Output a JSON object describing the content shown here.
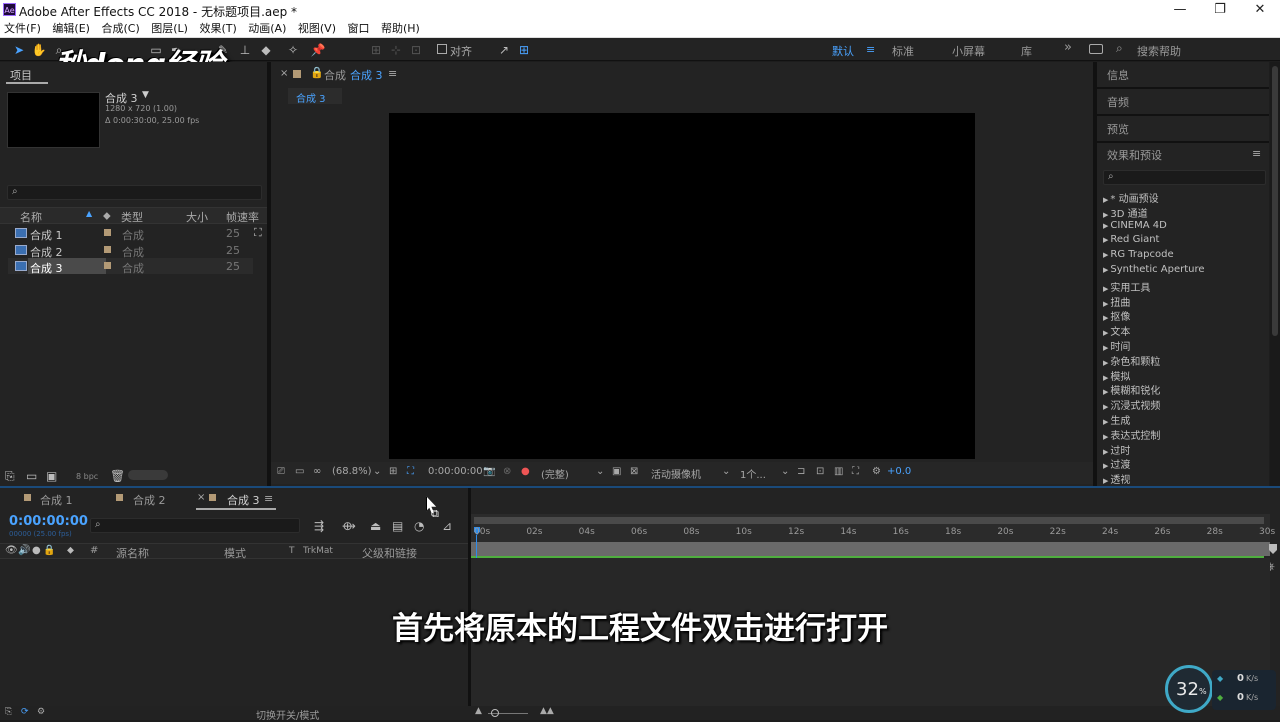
{
  "window": {
    "title": "Adobe After Effects CC 2018 - 无标题项目.aep *",
    "app_icon": "Ae",
    "controls": [
      "minimize-icon",
      "maximize-icon",
      "close-icon"
    ]
  },
  "menu": [
    "文件(F)",
    "编辑(E)",
    "合成(C)",
    "图层(L)",
    "效果(T)",
    "动画(A)",
    "视图(V)",
    "窗口",
    "帮助(H)"
  ],
  "toolbar": {
    "align_label": "对齐",
    "workspaces": [
      "默认",
      "标准",
      "小屏幕",
      "库"
    ],
    "active_workspace": "默认",
    "search_placeholder": "搜索帮助"
  },
  "watermark": "秒dong经验",
  "project": {
    "tab_label": "项目",
    "comp_name": "合成 3",
    "comp_res": "1280 x 720 (1.00)",
    "comp_dur": "Δ 0:00:30:00, 25.00 fps",
    "columns": [
      "名称",
      "类型",
      "大小",
      "帧速率"
    ],
    "items": [
      {
        "name": "合成 1",
        "type": "合成",
        "fps": "25"
      },
      {
        "name": "合成 2",
        "type": "合成",
        "fps": "25"
      },
      {
        "name": "合成 3",
        "type": "合成",
        "fps": "25"
      }
    ],
    "bpc": "8 bpc"
  },
  "composition": {
    "tab_label": "合成",
    "tab_active": "合成 3",
    "flow_label": "合成 3",
    "zoom": "(68.8%)",
    "timecode": "0:00:00:00",
    "quality": "(完整)",
    "camera": "活动摄像机",
    "views": "1个...",
    "exposure": "+0.0"
  },
  "right_panels": {
    "info": "信息",
    "audio": "音频",
    "preview": "预览",
    "effects_title": "效果和预设",
    "effects": [
      "* 动画预设",
      "3D 通道",
      "CINEMA 4D",
      "Red Giant",
      "RG Trapcode",
      "Synthetic Aperture",
      "实用工具",
      "扭曲",
      "抠像",
      "文本",
      "时间",
      "杂色和颗粒",
      "模拟",
      "模糊和锐化",
      "沉浸式视频",
      "生成",
      "表达式控制",
      "过时",
      "过渡",
      "透视"
    ]
  },
  "timeline": {
    "tabs": [
      "合成 1",
      "合成 2",
      "合成 3"
    ],
    "active_tab": "合成 3",
    "timecode": "0:00:00:00",
    "frame_info": "00000 (25.00 fps)",
    "columns": [
      "#",
      "源名称",
      "模式",
      "T",
      "TrkMat",
      "父级和链接"
    ],
    "ruler": [
      "00s",
      "02s",
      "04s",
      "06s",
      "08s",
      "10s",
      "12s",
      "14s",
      "16s",
      "18s",
      "20s",
      "22s",
      "24s",
      "26s",
      "28s",
      "30s"
    ],
    "footer": "切换开关/模式"
  },
  "subtitle": "首先将原本的工程文件双击进行打开",
  "net_widget": {
    "percent": "32",
    "percent_unit": "%",
    "up": "0",
    "down": "0",
    "unit": "K/s"
  },
  "colors": {
    "accent": "#2d8ceb",
    "background": "#232323",
    "label_tan": "#b39a76"
  }
}
